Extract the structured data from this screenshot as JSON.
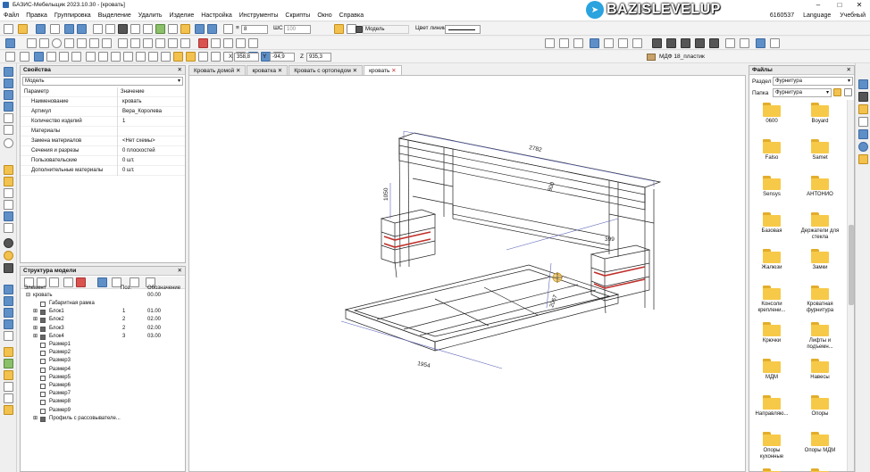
{
  "title": "БАЗИС-Мебельщик 2023.10.30 - [кровать]",
  "menu": [
    "Файл",
    "Правка",
    "Группировка",
    "Выделение",
    "Удалить",
    "Изделие",
    "Настройка",
    "Инструменты",
    "Скрипты",
    "Окно",
    "Справка"
  ],
  "menu_right": {
    "id": "6160537",
    "language": "Language",
    "mode": "Учебный"
  },
  "watermark": "BAZISLEVELUP",
  "toolbar": {
    "layer_value": "8",
    "shag_label": "ШС",
    "shag_value": "100",
    "model_label": "Модель",
    "line_color_label": "Цвет линии",
    "coords": {
      "x_label": "X",
      "x": "358,8",
      "y_label": "Y",
      "y": "-94,9",
      "z_label": "Z",
      "z": "935,3"
    },
    "material": "МДФ 18_пластик"
  },
  "properties": {
    "title": "Свойства",
    "object": "Модель",
    "col_param": "Параметр",
    "col_value": "Значение",
    "rows": [
      {
        "name": "Наименование",
        "value": "кровать"
      },
      {
        "name": "Артикул",
        "value": "Вера_Королева"
      },
      {
        "name": "Количество изделий",
        "value": "1"
      },
      {
        "name": "Материалы",
        "value": ""
      },
      {
        "name": "Замена материалов",
        "value": "<Нет схемы>"
      },
      {
        "name": "Сечения и разрезы",
        "value": "0 плоскостей"
      },
      {
        "name": "Пользовательские",
        "value": "0 шт."
      },
      {
        "name": "Дополнительные материалы",
        "value": "0 шт."
      }
    ]
  },
  "structure": {
    "title": "Структура модели",
    "col_element": "Элемент",
    "col_pos": "Поз.",
    "col_desig": "Обозначение",
    "root": {
      "name": "кровать",
      "desig": "00.00"
    },
    "items": [
      {
        "name": "Габаритная рамка",
        "pos": "",
        "desig": "",
        "expand": ""
      },
      {
        "name": "Блок1",
        "pos": "1",
        "desig": "01.00",
        "expand": "+"
      },
      {
        "name": "Блок2",
        "pos": "2",
        "desig": "02.00",
        "expand": "+"
      },
      {
        "name": "Блок3",
        "pos": "2",
        "desig": "02.00",
        "expand": "+"
      },
      {
        "name": "Блок4",
        "pos": "3",
        "desig": "03.00",
        "expand": "+"
      },
      {
        "name": "Размер1",
        "pos": "",
        "desig": "",
        "expand": ""
      },
      {
        "name": "Размер2",
        "pos": "",
        "desig": "",
        "expand": ""
      },
      {
        "name": "Размер3",
        "pos": "",
        "desig": "",
        "expand": ""
      },
      {
        "name": "Размер4",
        "pos": "",
        "desig": "",
        "expand": ""
      },
      {
        "name": "Размер5",
        "pos": "",
        "desig": "",
        "expand": ""
      },
      {
        "name": "Размер6",
        "pos": "",
        "desig": "",
        "expand": ""
      },
      {
        "name": "Размер7",
        "pos": "",
        "desig": "",
        "expand": ""
      },
      {
        "name": "Размер8",
        "pos": "",
        "desig": "",
        "expand": ""
      },
      {
        "name": "Размер9",
        "pos": "",
        "desig": "",
        "expand": ""
      },
      {
        "name": "Профиль с рассовывателе...",
        "pos": "",
        "desig": "",
        "expand": "+"
      }
    ]
  },
  "doc_tabs": [
    "Кровать домой",
    "кроватка",
    "Кровать с ортопедом",
    "кровать"
  ],
  "dimensions": {
    "top": "2782",
    "left_height": "1050",
    "front": "1954",
    "side": "2067",
    "inner1": "800",
    "inner2": "399"
  },
  "files": {
    "title": "Файлы",
    "section_label": "Раздел",
    "section_value": "Фурнитура",
    "folder_label": "Папка",
    "folder_value": "Фурнитура",
    "items": [
      "0600",
      "Boyard",
      "Falso",
      "Samet",
      "Sensys",
      "АНТОНИО",
      "Базовая",
      "Держатели для стекла",
      "Жалюзи",
      "Замки",
      "Консоли креплени...",
      "Кроватная фурнитура",
      "Крючки",
      "Лифты и подъемн...",
      "МДМ",
      "Навесы",
      "Направляю...",
      "Опоры",
      "Опоры кухонные",
      "Опоры МДМ",
      "",
      ""
    ]
  }
}
